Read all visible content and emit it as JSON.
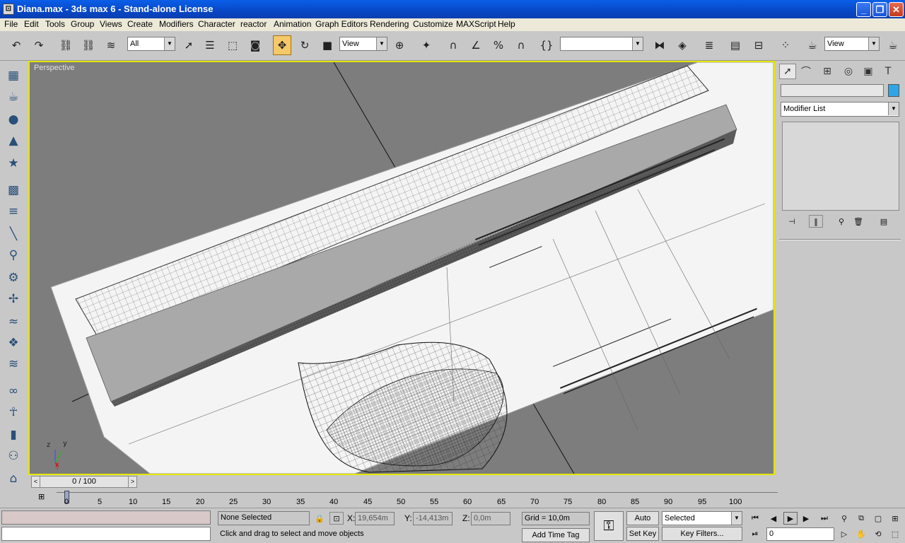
{
  "window": {
    "title": "Diana.max - 3ds max 6 - Stand-alone License"
  },
  "menu": [
    "File",
    "Edit",
    "Tools",
    "Group",
    "Views",
    "Create",
    "Modifiers",
    "Character",
    "reactor",
    "Animation",
    "Graph Editors",
    "Rendering",
    "Customize",
    "MAXScript",
    "Help"
  ],
  "toolbar": {
    "selection_filter": "All",
    "ref_coord": "View",
    "named_selection": "",
    "render_view": "View"
  },
  "viewport": {
    "label": "Perspective",
    "axis_x": "x",
    "axis_y": "y",
    "axis_z": "z"
  },
  "command_panel": {
    "object_name": "",
    "modifier_list": "Modifier List",
    "color_swatch": "#2fa5e6"
  },
  "timeline": {
    "slider": "0 / 100",
    "ticks": [
      "0",
      "5",
      "10",
      "15",
      "20",
      "25",
      "30",
      "35",
      "40",
      "45",
      "50",
      "55",
      "60",
      "65",
      "70",
      "75",
      "80",
      "85",
      "90",
      "95",
      "100"
    ]
  },
  "status": {
    "selection": "None Selected",
    "prompt": "Click and drag to select and move objects",
    "x_label": "X:",
    "x_value": "19,654m",
    "y_label": "Y:",
    "y_value": "-14,413m",
    "z_label": "Z:",
    "z_value": "0,0m",
    "grid": "Grid = 10,0m",
    "add_time_tag": "Add Time Tag",
    "auto_key": "Auto Key",
    "set_key": "Set Key",
    "key_mode": "Selected",
    "key_filters": "Key Filters...",
    "frame": "0"
  },
  "colors": {
    "titlebar": "#0a5fe8",
    "viewport_border": "#e6e600",
    "active_tool": "#f5c96a"
  }
}
